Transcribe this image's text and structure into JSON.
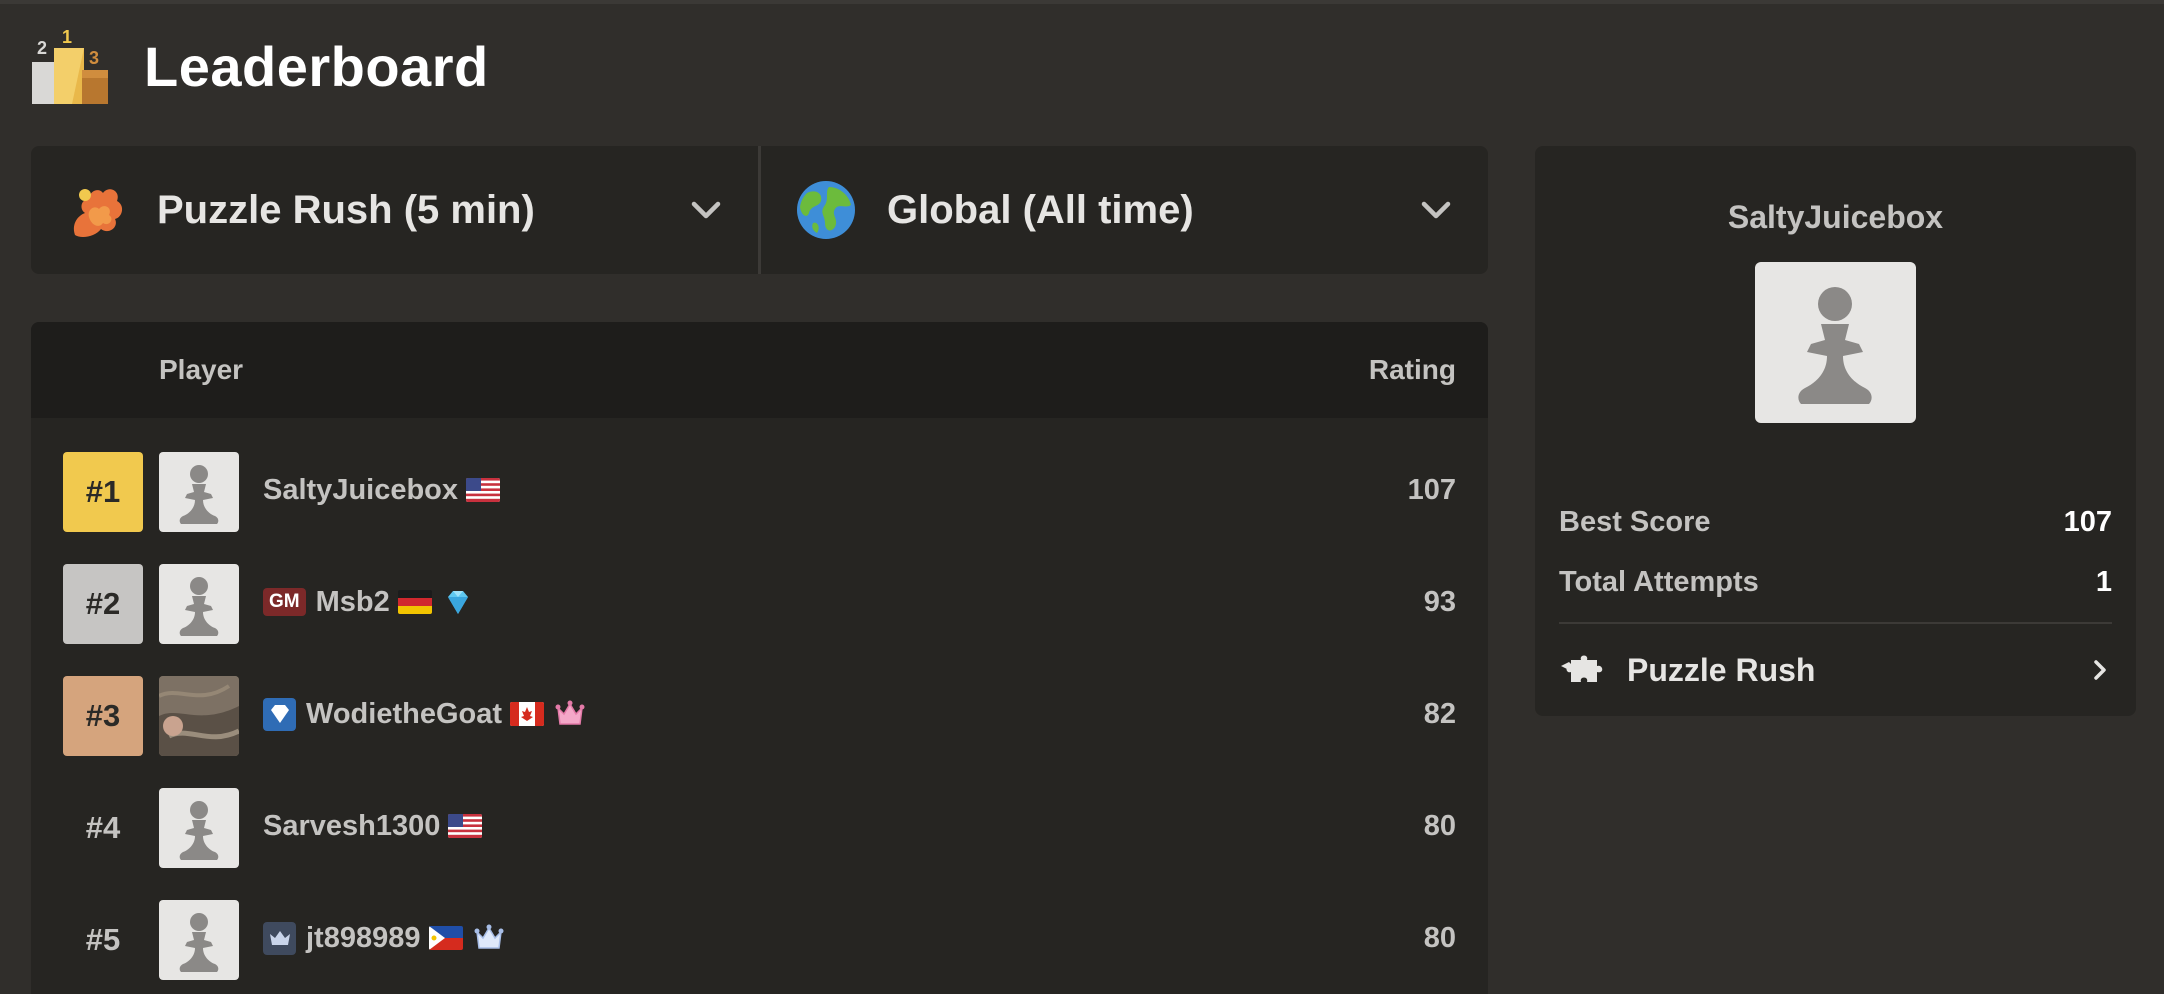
{
  "header": {
    "title": "Leaderboard",
    "icon": "podium-icon"
  },
  "filters": {
    "mode": {
      "label": "Puzzle Rush (5 min)",
      "icon": "puzzle-rush-icon"
    },
    "scope": {
      "label": "Global (All time)",
      "icon": "globe-icon"
    }
  },
  "table": {
    "columns": {
      "player": "Player",
      "rating": "Rating"
    },
    "rows": [
      {
        "rank": "#1",
        "username": "SaltyJuicebox",
        "flag": "us",
        "rating": "107",
        "rank_color": "#f1c94e"
      },
      {
        "rank": "#2",
        "username": "Msb2",
        "title": "GM",
        "flag": "de",
        "extra_icon": "diamond-icon",
        "rating": "93",
        "rank_color": "#c6c5c3"
      },
      {
        "rank": "#3",
        "username": "WodietheGoat",
        "badge_icon": "diamond-badge-icon",
        "flag": "ca",
        "extra_icon": "crown-icon",
        "rating": "82",
        "rank_color": "#d5a47d"
      },
      {
        "rank": "#4",
        "username": "Sarvesh1300",
        "flag": "us",
        "rating": "80"
      },
      {
        "rank": "#5",
        "username": "jt898989",
        "badge_icon": "crown-badge-icon",
        "flag": "ph",
        "extra_icon": "crown-icon",
        "rating": "80"
      }
    ]
  },
  "profile": {
    "username": "SaltyJuicebox",
    "stats": [
      {
        "label": "Best Score",
        "value": "107"
      },
      {
        "label": "Total Attempts",
        "value": "1"
      }
    ],
    "link_label": "Puzzle Rush"
  },
  "colors": {
    "background": "#302e2b",
    "panel": "#262522",
    "gold": "#f1c94e",
    "silver": "#c6c5c3",
    "bronze": "#d5a47d"
  }
}
